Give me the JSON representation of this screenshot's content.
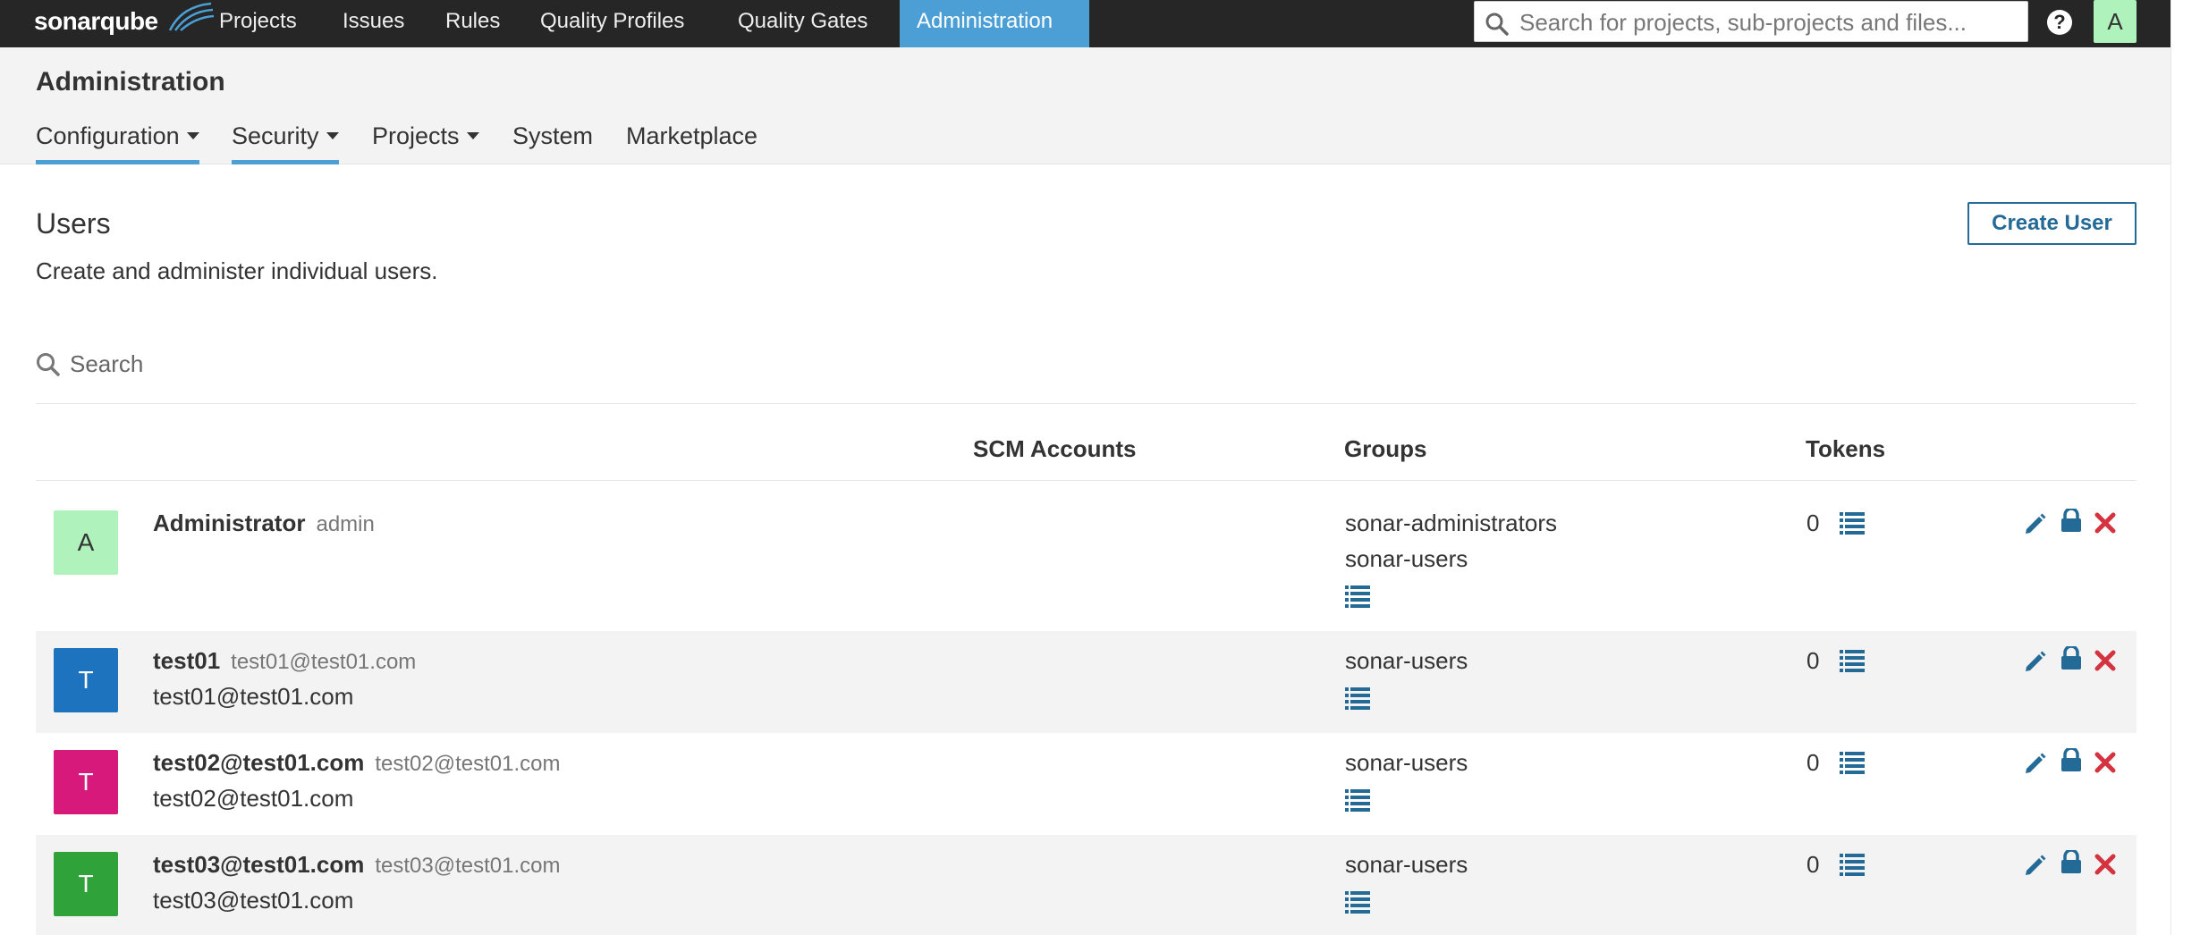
{
  "topnav": {
    "logo": "sonarqube",
    "items": [
      "Projects",
      "Issues",
      "Rules",
      "Quality Profiles",
      "Quality Gates",
      "Administration"
    ],
    "active_item": "Administration",
    "search_placeholder": "Search for projects, sub-projects and files...",
    "help": "?",
    "avatar_letter": "A"
  },
  "admin": {
    "title": "Administration",
    "tabs": [
      {
        "label": "Configuration",
        "dropdown": true
      },
      {
        "label": "Security",
        "dropdown": true
      },
      {
        "label": "Projects",
        "dropdown": true
      },
      {
        "label": "System",
        "dropdown": false
      },
      {
        "label": "Marketplace",
        "dropdown": false
      }
    ]
  },
  "page": {
    "title": "Users",
    "description": "Create and administer individual users.",
    "create_button": "Create User",
    "search_placeholder": "Search"
  },
  "table": {
    "headers": {
      "scm": "SCM Accounts",
      "groups": "Groups",
      "tokens": "Tokens"
    },
    "rows": [
      {
        "avatar": "A",
        "avatar_color": "#b0f2bc",
        "avatar_text_color": "#333333",
        "name": "Administrator",
        "login": "admin",
        "email": "",
        "groups": [
          "sonar-administrators",
          "sonar-users"
        ],
        "tokens": "0"
      },
      {
        "avatar": "T",
        "avatar_color": "#1e73be",
        "avatar_text_color": "#ffffff",
        "name": "test01",
        "login": "test01@test01.com",
        "email": "test01@test01.com",
        "groups": [
          "sonar-users"
        ],
        "tokens": "0"
      },
      {
        "avatar": "T",
        "avatar_color": "#d8197c",
        "avatar_text_color": "#ffffff",
        "name": "test02@test01.com",
        "login": "test02@test01.com",
        "email": "test02@test01.com",
        "groups": [
          "sonar-users"
        ],
        "tokens": "0"
      },
      {
        "avatar": "T",
        "avatar_color": "#2fa339",
        "avatar_text_color": "#ffffff",
        "name": "test03@test01.com",
        "login": "test03@test01.com",
        "email": "test03@test01.com",
        "groups": [
          "sonar-users"
        ],
        "tokens": "0"
      }
    ]
  },
  "icons": {
    "list": "list-icon",
    "edit": "pencil-icon",
    "password": "lock-icon",
    "deactivate": "close-icon"
  },
  "colors": {
    "accent": "#4b9fd5",
    "link": "#236a97",
    "danger": "#d4333f",
    "navbar": "#262626"
  }
}
